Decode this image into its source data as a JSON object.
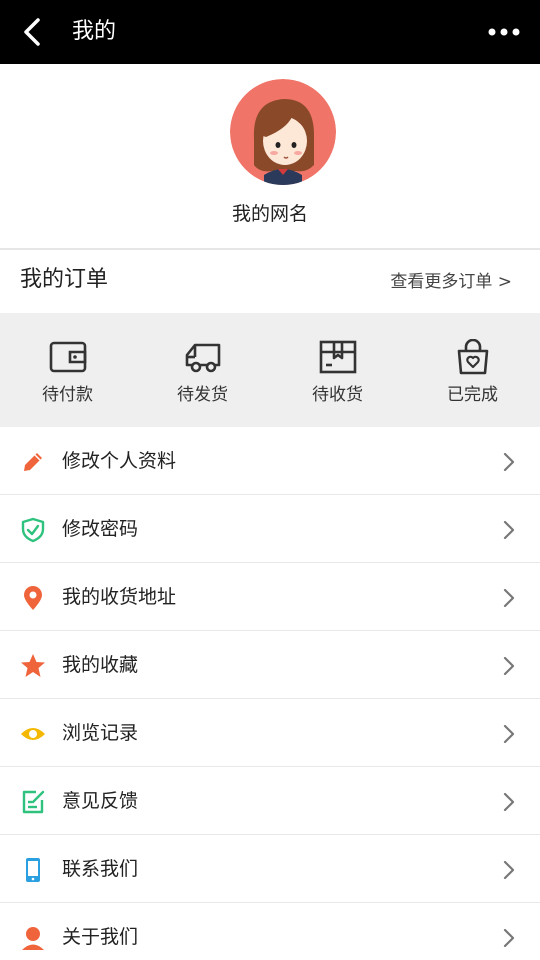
{
  "header": {
    "title": "我的"
  },
  "profile": {
    "nickname": "我的网名"
  },
  "orders": {
    "title": "我的订单",
    "more_label": "查看更多订单 >",
    "items": [
      {
        "label": "待付款",
        "icon": "wallet-icon"
      },
      {
        "label": "待发货",
        "icon": "truck-icon"
      },
      {
        "label": "待收货",
        "icon": "package-icon"
      },
      {
        "label": "已完成",
        "icon": "bag-icon"
      }
    ]
  },
  "menu": {
    "items": [
      {
        "label": "修改个人资料",
        "icon": "pencil-icon",
        "color": "#f0643c"
      },
      {
        "label": "修改密码",
        "icon": "shield-check-icon",
        "color": "#2ec27e"
      },
      {
        "label": "我的收货地址",
        "icon": "location-pin-icon",
        "color": "#f0643c"
      },
      {
        "label": "我的收藏",
        "icon": "star-icon",
        "color": "#f0643c"
      },
      {
        "label": "浏览记录",
        "icon": "eye-icon",
        "color": "#f5b800"
      },
      {
        "label": "意见反馈",
        "icon": "feedback-edit-icon",
        "color": "#2ec27e"
      },
      {
        "label": "联系我们",
        "icon": "phone-icon",
        "color": "#2aa0e0"
      },
      {
        "label": "关于我们",
        "icon": "user-icon",
        "color": "#f0643c"
      }
    ]
  }
}
